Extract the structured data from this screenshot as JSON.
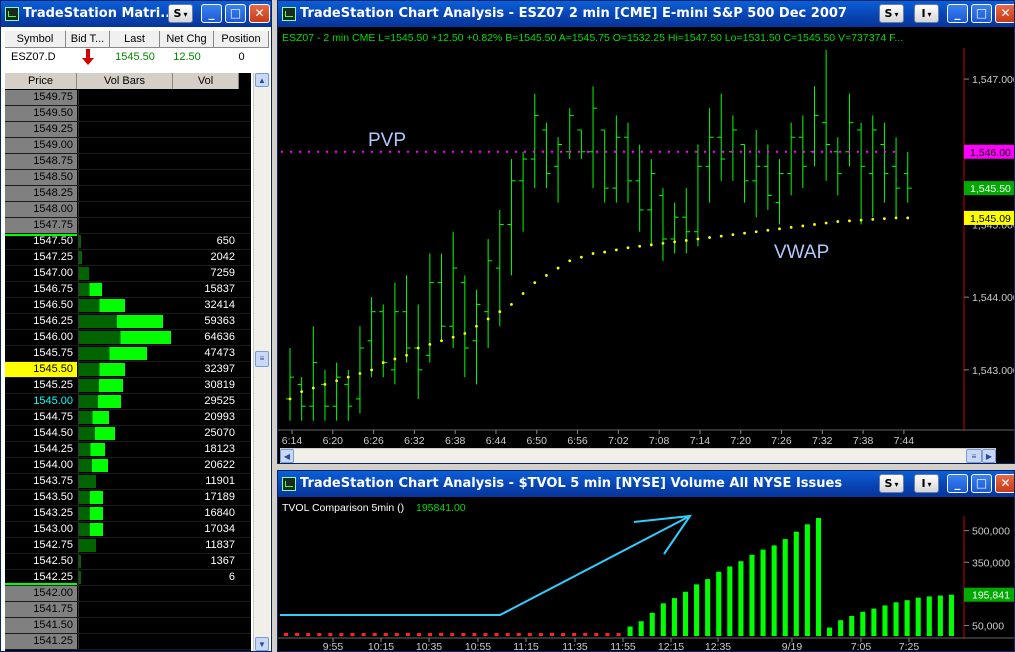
{
  "matrix": {
    "title": "TradeStation Matri...",
    "headers": [
      "Symbol",
      "Bid T...",
      "Last",
      "Net Chg",
      "Position"
    ],
    "symbol": "ESZ07.D",
    "last": "1545.50",
    "net_chg": "12.50",
    "position": "0",
    "columns": [
      "Price",
      "Vol Bars",
      "Vol"
    ],
    "rows": [
      {
        "price": "1549.75",
        "vol": ""
      },
      {
        "price": "1549.50",
        "vol": ""
      },
      {
        "price": "1549.25",
        "vol": ""
      },
      {
        "price": "1549.00",
        "vol": ""
      },
      {
        "price": "1548.75",
        "vol": ""
      },
      {
        "price": "1548.50",
        "vol": ""
      },
      {
        "price": "1548.25",
        "vol": ""
      },
      {
        "price": "1548.00",
        "vol": ""
      },
      {
        "price": "1547.75",
        "vol": ""
      },
      {
        "price": "1547.50",
        "vol": "650"
      },
      {
        "price": "1547.25",
        "vol": "2042"
      },
      {
        "price": "1547.00",
        "vol": "7259"
      },
      {
        "price": "1546.75",
        "vol": "15837"
      },
      {
        "price": "1546.50",
        "vol": "32414"
      },
      {
        "price": "1546.25",
        "vol": "59363"
      },
      {
        "price": "1546.00",
        "vol": "64636"
      },
      {
        "price": "1545.75",
        "vol": "47473"
      },
      {
        "price": "1545.50",
        "vol": "32397"
      },
      {
        "price": "1545.25",
        "vol": "30819"
      },
      {
        "price": "1545.00",
        "vol": "29525"
      },
      {
        "price": "1544.75",
        "vol": "20993"
      },
      {
        "price": "1544.50",
        "vol": "25070"
      },
      {
        "price": "1544.25",
        "vol": "18123"
      },
      {
        "price": "1544.00",
        "vol": "20622"
      },
      {
        "price": "1543.75",
        "vol": "11901"
      },
      {
        "price": "1543.50",
        "vol": "17189"
      },
      {
        "price": "1543.25",
        "vol": "16840"
      },
      {
        "price": "1543.00",
        "vol": "17034"
      },
      {
        "price": "1542.75",
        "vol": "11837"
      },
      {
        "price": "1542.50",
        "vol": "1367"
      },
      {
        "price": "1542.25",
        "vol": "6"
      },
      {
        "price": "1542.00",
        "vol": ""
      },
      {
        "price": "1541.75",
        "vol": ""
      },
      {
        "price": "1541.50",
        "vol": ""
      },
      {
        "price": "1541.25",
        "vol": ""
      }
    ],
    "last_marker": "1",
    "vwap_marker": "v",
    "colors": {
      "last_row": "#ffff00",
      "vwap_text": "#00ffff",
      "bar_dark": "#006400",
      "bar_light": "#00ff00"
    }
  },
  "chart1": {
    "title": "TradeStation Chart Analysis - ESZ07  2 min  [CME] E-mini S&P 500 Dec 2007",
    "status": "ESZ07 - 2 min   CME  L=1545.50  +12.50  +0.82%  B=1545.50  A=1545.75  O=1532.25  Hi=1547.50  Lo=1531.50  C=1545.50  V=737374  F...",
    "pvp_label": "PVP",
    "vwap_label": "VWAP",
    "axis_tags": {
      "pvp": "1,546.00",
      "last": "1,545.50",
      "vwap": "1,545.09"
    },
    "colors": {
      "bars": "#00ff00",
      "pvp": "#ff00ff",
      "vwap": "#ffff00",
      "label": "#b0c8ff"
    }
  },
  "chart2": {
    "title": "TradeStation Chart Analysis - $TVOL  5 min  [NYSE] Volume All NYSE Issues",
    "status_label": "TVOL Comparison 5min  ()",
    "status_value": "195841.00",
    "axis_tag": "195,841",
    "colors": {
      "bars": "#00ff00",
      "arrow": "#33ccff",
      "base": "#ff2222"
    }
  },
  "chart_data": [
    {
      "type": "ohlc",
      "name": "ESZ07 2 min",
      "x_ticks": [
        "6:14",
        "6:20",
        "6:26",
        "6:32",
        "6:38",
        "6:44",
        "6:50",
        "6:56",
        "7:02",
        "7:08",
        "7:14",
        "7:20",
        "7:26",
        "7:32",
        "7:38",
        "7:44"
      ],
      "y_ticks": [
        1543.0,
        1544.0,
        1545.0,
        1546.0,
        1547.0
      ],
      "ylim": [
        1542.2,
        1547.4
      ],
      "bars": [
        {
          "h": 1543.3,
          "l": 1542.3,
          "o": 1542.6,
          "c": 1542.9
        },
        {
          "h": 1542.9,
          "l": 1542.3,
          "o": 1542.8,
          "c": 1542.5
        },
        {
          "h": 1543.6,
          "l": 1542.3,
          "o": 1542.5,
          "c": 1543.1
        },
        {
          "h": 1543.0,
          "l": 1542.3,
          "o": 1542.8,
          "c": 1542.5
        },
        {
          "h": 1543.1,
          "l": 1542.3,
          "o": 1542.5,
          "c": 1542.9
        },
        {
          "h": 1543.0,
          "l": 1542.3,
          "o": 1542.8,
          "c": 1542.5
        },
        {
          "h": 1543.6,
          "l": 1542.4,
          "o": 1542.6,
          "c": 1543.3
        },
        {
          "h": 1544.0,
          "l": 1542.9,
          "o": 1543.4,
          "c": 1543.8
        },
        {
          "h": 1543.9,
          "l": 1542.9,
          "o": 1543.8,
          "c": 1543.1
        },
        {
          "h": 1544.2,
          "l": 1542.8,
          "o": 1543.0,
          "c": 1543.8
        },
        {
          "h": 1544.3,
          "l": 1543.1,
          "o": 1543.8,
          "c": 1543.3
        },
        {
          "h": 1543.9,
          "l": 1542.6,
          "o": 1543.3,
          "c": 1543.0
        },
        {
          "h": 1544.6,
          "l": 1543.1,
          "o": 1543.2,
          "c": 1544.2
        },
        {
          "h": 1544.6,
          "l": 1543.4,
          "o": 1544.2,
          "c": 1543.6
        },
        {
          "h": 1544.9,
          "l": 1543.3,
          "o": 1543.6,
          "c": 1544.4
        },
        {
          "h": 1544.3,
          "l": 1542.9,
          "o": 1544.2,
          "c": 1543.3
        },
        {
          "h": 1544.1,
          "l": 1542.8,
          "o": 1543.4,
          "c": 1543.9
        },
        {
          "h": 1544.8,
          "l": 1543.3,
          "o": 1543.8,
          "c": 1544.5
        },
        {
          "h": 1545.2,
          "l": 1543.6,
          "o": 1544.4,
          "c": 1545.0
        },
        {
          "h": 1545.9,
          "l": 1544.3,
          "o": 1545.0,
          "c": 1545.6
        },
        {
          "h": 1546.0,
          "l": 1544.9,
          "o": 1545.6,
          "c": 1545.9
        },
        {
          "h": 1546.8,
          "l": 1545.5,
          "o": 1545.9,
          "c": 1546.5
        },
        {
          "h": 1546.4,
          "l": 1545.5,
          "o": 1546.3,
          "c": 1545.7
        },
        {
          "h": 1546.2,
          "l": 1545.3,
          "o": 1545.8,
          "c": 1546.1
        },
        {
          "h": 1546.6,
          "l": 1545.9,
          "o": 1546.0,
          "c": 1546.5
        },
        {
          "h": 1546.3,
          "l": 1545.9,
          "o": 1546.3,
          "c": 1546.0
        },
        {
          "h": 1546.9,
          "l": 1545.5,
          "o": 1546.0,
          "c": 1546.6
        },
        {
          "h": 1546.3,
          "l": 1545.3,
          "o": 1546.3,
          "c": 1545.5
        },
        {
          "h": 1546.5,
          "l": 1545.3,
          "o": 1545.5,
          "c": 1546.2
        },
        {
          "h": 1546.4,
          "l": 1545.3,
          "o": 1546.2,
          "c": 1545.6
        },
        {
          "h": 1546.1,
          "l": 1544.9,
          "o": 1545.6,
          "c": 1545.2
        },
        {
          "h": 1545.9,
          "l": 1544.7,
          "o": 1545.2,
          "c": 1545.7
        },
        {
          "h": 1545.5,
          "l": 1544.5,
          "o": 1545.4,
          "c": 1544.8
        },
        {
          "h": 1545.3,
          "l": 1544.6,
          "o": 1544.8,
          "c": 1545.1
        },
        {
          "h": 1545.5,
          "l": 1544.6,
          "o": 1545.1,
          "c": 1544.9
        },
        {
          "h": 1546.1,
          "l": 1544.7,
          "o": 1544.9,
          "c": 1545.8
        },
        {
          "h": 1546.6,
          "l": 1545.3,
          "o": 1545.8,
          "c": 1546.2
        },
        {
          "h": 1546.8,
          "l": 1545.6,
          "o": 1546.2,
          "c": 1545.9
        },
        {
          "h": 1546.5,
          "l": 1545.6,
          "o": 1546.0,
          "c": 1546.3
        },
        {
          "h": 1546.1,
          "l": 1545.3,
          "o": 1546.1,
          "c": 1545.6
        },
        {
          "h": 1546.3,
          "l": 1545.1,
          "o": 1545.6,
          "c": 1545.8
        },
        {
          "h": 1546.1,
          "l": 1545.2,
          "o": 1545.8,
          "c": 1545.4
        },
        {
          "h": 1545.9,
          "l": 1545.0,
          "o": 1545.3,
          "c": 1545.7
        },
        {
          "h": 1546.4,
          "l": 1545.4,
          "o": 1545.7,
          "c": 1546.2
        },
        {
          "h": 1546.5,
          "l": 1545.5,
          "o": 1546.2,
          "c": 1545.8
        },
        {
          "h": 1546.9,
          "l": 1545.8,
          "o": 1546.0,
          "c": 1546.5
        },
        {
          "h": 1547.4,
          "l": 1545.6,
          "o": 1546.4,
          "c": 1546.1
        },
        {
          "h": 1546.2,
          "l": 1545.4,
          "o": 1546.0,
          "c": 1545.7
        },
        {
          "h": 1546.8,
          "l": 1545.8,
          "o": 1546.0,
          "c": 1546.4
        },
        {
          "h": 1546.4,
          "l": 1545.0,
          "o": 1546.3,
          "c": 1545.8
        },
        {
          "h": 1546.5,
          "l": 1545.1,
          "o": 1545.7,
          "c": 1546.3
        },
        {
          "h": 1546.4,
          "l": 1545.3,
          "o": 1546.1,
          "c": 1545.7
        },
        {
          "h": 1546.2,
          "l": 1545.1,
          "o": 1545.8,
          "c": 1545.5
        },
        {
          "h": 1546.0,
          "l": 1545.3,
          "o": 1545.7,
          "c": 1545.5
        }
      ],
      "pvp": 1546.0,
      "vwap": [
        1542.6,
        1542.7,
        1542.75,
        1542.8,
        1542.85,
        1542.9,
        1542.95,
        1543.0,
        1543.1,
        1543.15,
        1543.2,
        1543.3,
        1543.35,
        1543.4,
        1543.45,
        1543.5,
        1543.6,
        1543.7,
        1543.8,
        1543.9,
        1544.05,
        1544.2,
        1544.3,
        1544.4,
        1544.5,
        1544.55,
        1544.6,
        1544.62,
        1544.65,
        1544.68,
        1544.7,
        1544.72,
        1544.74,
        1544.76,
        1544.78,
        1544.8,
        1544.82,
        1544.84,
        1544.86,
        1544.88,
        1544.9,
        1544.92,
        1544.94,
        1544.96,
        1544.98,
        1545.0,
        1545.02,
        1545.04,
        1545.05,
        1545.06,
        1545.07,
        1545.08,
        1545.09,
        1545.09
      ]
    },
    {
      "type": "bar",
      "name": "TVOL Comparison 5min",
      "x_ticks": [
        "9:55",
        "10:15",
        "10:35",
        "10:55",
        "11:15",
        "11:35",
        "11:55",
        "12:15",
        "12:35",
        "9/19",
        "7:05",
        "7:25"
      ],
      "y_ticks": [
        50000,
        350000,
        500000
      ],
      "ylim": [
        0,
        560000
      ],
      "values": [
        0,
        0,
        0,
        0,
        0,
        0,
        0,
        0,
        0,
        0,
        0,
        0,
        0,
        0,
        0,
        0,
        0,
        0,
        0,
        0,
        0,
        0,
        0,
        0,
        0,
        0,
        0,
        0,
        0,
        0,
        0,
        45000,
        70000,
        110000,
        155000,
        180000,
        210000,
        245000,
        270000,
        305000,
        330000,
        355000,
        385000,
        410000,
        430000,
        460000,
        495000,
        530000,
        560000,
        40000,
        75000,
        95000,
        115000,
        130000,
        145000,
        160000,
        170000,
        182000,
        188000,
        192000,
        195841
      ]
    }
  ]
}
